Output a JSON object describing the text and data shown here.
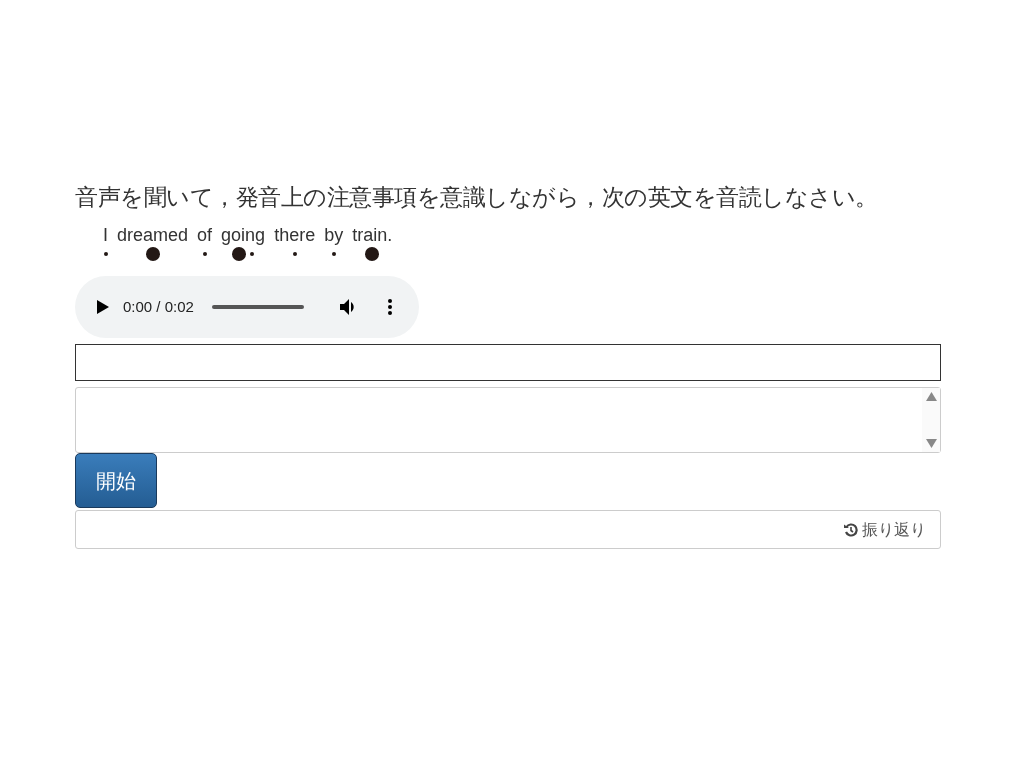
{
  "question": "音声を聞いて，発音上の注意事項を意識しながら，次の英文を音読しなさい。",
  "sentence": [
    {
      "word": "I",
      "dots": [
        {
          "stressed": false
        }
      ]
    },
    {
      "word": "dreamed",
      "dots": [
        {
          "stressed": true
        }
      ]
    },
    {
      "word": "of",
      "dots": [
        {
          "stressed": false
        }
      ]
    },
    {
      "word": "going",
      "dots": [
        {
          "stressed": true
        },
        {
          "stressed": false
        }
      ]
    },
    {
      "word": "there",
      "dots": [
        {
          "stressed": false
        }
      ]
    },
    {
      "word": "by",
      "dots": [
        {
          "stressed": false
        }
      ]
    },
    {
      "word": "train.",
      "dots": [
        {
          "stressed": true
        }
      ]
    }
  ],
  "audio": {
    "time": "0:00 / 0:02"
  },
  "start_button": "開始",
  "review_link": "振り返り"
}
